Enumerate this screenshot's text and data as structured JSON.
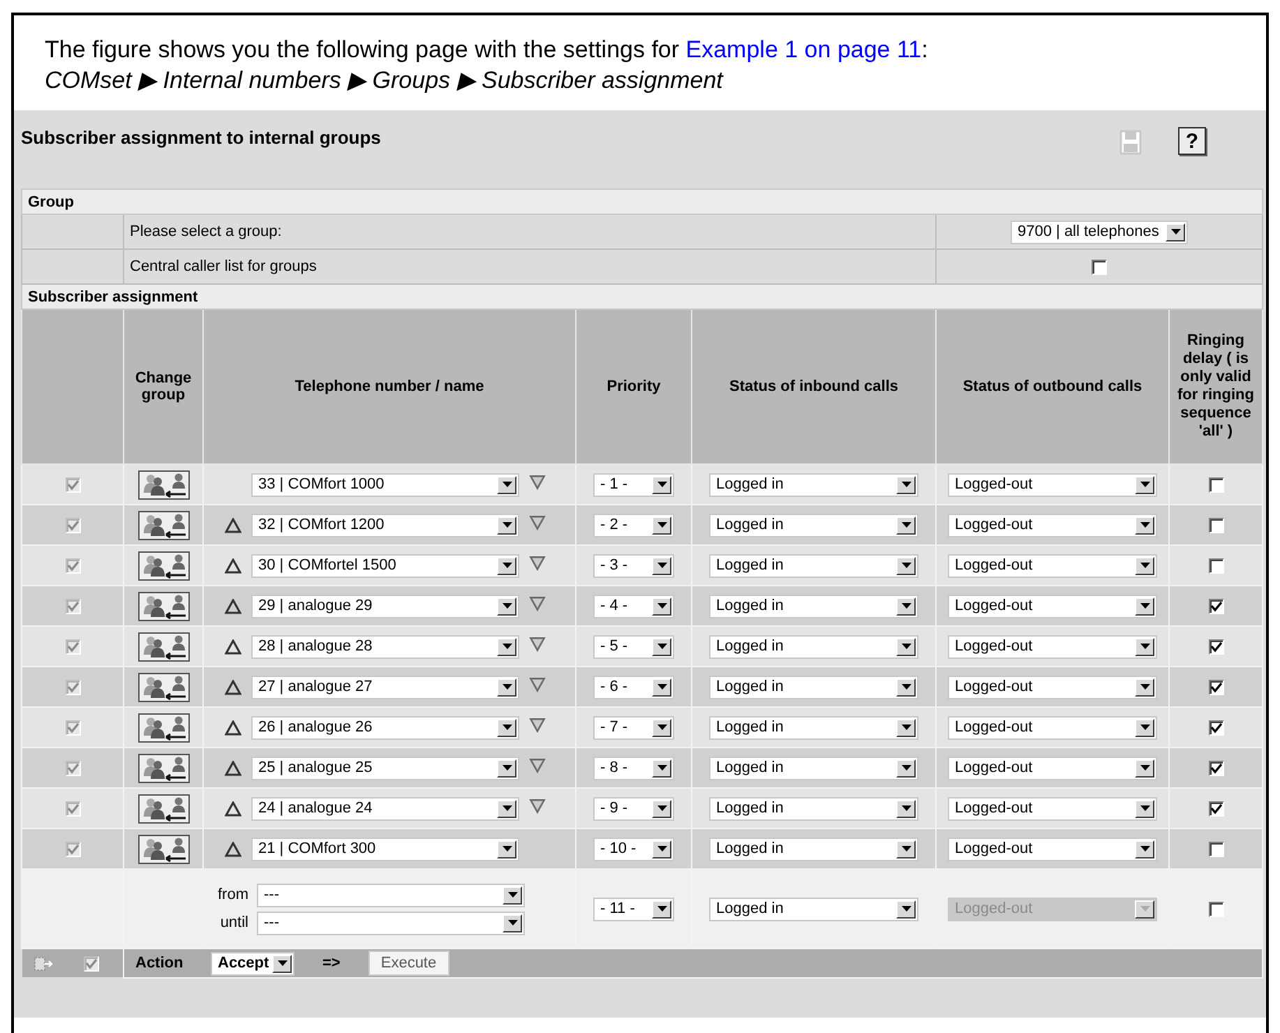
{
  "intro": {
    "text_before": "The figure shows you the following page with the settings for ",
    "link": "Example 1 on page 11",
    "text_after": ":",
    "path": "COMset ▶ Internal numbers ▶ Groups ▶ Subscriber assignment"
  },
  "page": {
    "title": "Subscriber assignment to internal groups",
    "save_disabled": true,
    "help_label": "?"
  },
  "group_section": {
    "title": "Group",
    "select_label": "Please select a group:",
    "group_value": "9700 | all telephones",
    "caller_list_label": "Central caller list for groups",
    "caller_list_checked": false
  },
  "assignment_section": {
    "title": "Subscriber assignment"
  },
  "table": {
    "columns": [
      "Change group",
      "Telephone number / name",
      "Priority",
      "Status of inbound calls",
      "Status of outbound calls",
      "Ringing delay ( is only valid for ringing sequence 'all' )"
    ],
    "rows": [
      {
        "checked": true,
        "up": false,
        "down": true,
        "number": "33 | COMfort 1000",
        "priority": "- 1 -",
        "inbound": "Logged in",
        "outbound": "Logged-out",
        "ringing_delay": false
      },
      {
        "checked": true,
        "up": true,
        "down": true,
        "number": "32 | COMfort 1200",
        "priority": "- 2 -",
        "inbound": "Logged in",
        "outbound": "Logged-out",
        "ringing_delay": false
      },
      {
        "checked": true,
        "up": true,
        "down": true,
        "number": "30 | COMfortel 1500",
        "priority": "- 3 -",
        "inbound": "Logged in",
        "outbound": "Logged-out",
        "ringing_delay": false
      },
      {
        "checked": true,
        "up": true,
        "down": true,
        "number": "29 | analogue 29",
        "priority": "- 4 -",
        "inbound": "Logged in",
        "outbound": "Logged-out",
        "ringing_delay": true
      },
      {
        "checked": true,
        "up": true,
        "down": true,
        "number": "28 | analogue 28",
        "priority": "- 5 -",
        "inbound": "Logged in",
        "outbound": "Logged-out",
        "ringing_delay": true
      },
      {
        "checked": true,
        "up": true,
        "down": true,
        "number": "27 | analogue 27",
        "priority": "- 6 -",
        "inbound": "Logged in",
        "outbound": "Logged-out",
        "ringing_delay": true
      },
      {
        "checked": true,
        "up": true,
        "down": true,
        "number": "26 | analogue 26",
        "priority": "- 7 -",
        "inbound": "Logged in",
        "outbound": "Logged-out",
        "ringing_delay": true
      },
      {
        "checked": true,
        "up": true,
        "down": true,
        "number": "25 | analogue 25",
        "priority": "- 8 -",
        "inbound": "Logged in",
        "outbound": "Logged-out",
        "ringing_delay": true
      },
      {
        "checked": true,
        "up": true,
        "down": true,
        "number": "24 | analogue 24",
        "priority": "- 9 -",
        "inbound": "Logged in",
        "outbound": "Logged-out",
        "ringing_delay": true
      },
      {
        "checked": true,
        "up": true,
        "down": false,
        "number": "21 | COMfort 300",
        "priority": "- 10 -",
        "inbound": "Logged in",
        "outbound": "Logged-out",
        "ringing_delay": false
      }
    ],
    "new_row": {
      "from_label": "from",
      "from_value": "---",
      "until_label": "until",
      "until_value": "---",
      "priority": "- 11 -",
      "inbound": "Logged in",
      "outbound": "Logged-out",
      "outbound_disabled": true,
      "ringing_delay": false
    }
  },
  "footer": {
    "select_all_checked": true,
    "action_label": "Action",
    "action_value": "Accept",
    "arrow": "=>",
    "execute_label": "Execute"
  }
}
